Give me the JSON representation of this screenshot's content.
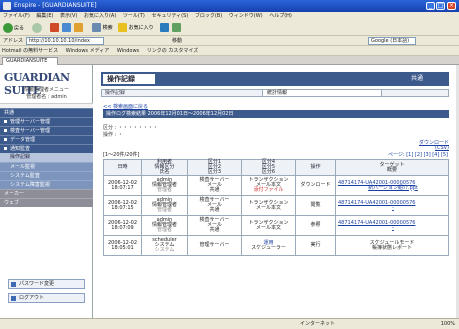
{
  "window": {
    "title": "Enspire - [GUARDIANSUITE]"
  },
  "menu": [
    "ファイル(F)",
    "編集(E)",
    "表示(V)",
    "お気に入り(A)",
    "ツール(T)",
    "セキュリティ(S)",
    "ブロック(B)",
    "ウィンドウ(W)",
    "ヘルプ(H)"
  ],
  "toolbar": {
    "back": "戻る",
    "search_label": "検索",
    "favorites_label": "お気に入り"
  },
  "address": {
    "label": "アドレス",
    "value": "http://10.10.10.10/index",
    "go": "移動",
    "search_field": "Google (日本語)"
  },
  "links": [
    "Hotmail の無料サービス",
    "Windows メディア",
    "Windows",
    "リンクの カスタマイズ"
  ],
  "tab": {
    "label": "GUARDIANSUITE"
  },
  "sidebar": {
    "logo": "GUARDIAN SUITE",
    "user_line1": "情報管理者メニュー",
    "user_line2": "管理者名 : admin",
    "items": [
      {
        "label": "共通",
        "style": "dark"
      },
      {
        "label": "管理サーバー管理",
        "style": "dark"
      },
      {
        "label": "検査サーバー管理",
        "style": "dark"
      },
      {
        "label": "データ管理",
        "style": "dark"
      },
      {
        "label": "通知監査",
        "style": "dark"
      },
      {
        "label": "操作記録",
        "style": "sel"
      },
      {
        "label": "メール監視",
        "style": "light"
      },
      {
        "label": "システム監査",
        "style": "light"
      },
      {
        "label": "システム障害監視",
        "style": "light"
      },
      {
        "label": "メーカー",
        "style": "gray"
      },
      {
        "label": "ウェブ",
        "style": "gray"
      }
    ],
    "password_button": "パスワード変更",
    "logout_button": "ログアウト"
  },
  "main": {
    "header_title": "操作記録",
    "header_right": "共通",
    "category_label": "操作記録",
    "category_value": "統計情報",
    "back_link": "<< 検索画面に戻る",
    "section_title": "操作ログ検索結果 2006年12月01日～2006年12月02日",
    "info_line1": "区分 : ・・・・・・・・",
    "info_line2": "操作 : ・",
    "download": "ダウンロード",
    "download_sub": "(CSV)",
    "count": "[1～20件/20件]",
    "pager": "ページ: [1] [2] [3] [4] [5]",
    "columns": [
      "日時",
      "利用者\n情報区分\n氏名",
      "区分1\n区分2\n区分3",
      "区分4\n区分5\n区分6",
      "操作",
      "ターゲット\n概要"
    ],
    "rows": [
      {
        "date": "2006-12-02",
        "time": "18:07:17",
        "u1": "admin",
        "u2": "情報管理者",
        "u3": "管理者",
        "c1": "検査サーバー",
        "c2": "メール",
        "c3": "共通",
        "d1": "トランザクション",
        "d2": "メール本文",
        "d3": "添付ファイル",
        "op": "ダウンロード",
        "t1": "48714174-UA42001-00000576",
        "t2": "新バージョン紹介.ppt"
      },
      {
        "date": "2006-12-02",
        "time": "18:07:15",
        "u1": "admin",
        "u2": "情報管理者",
        "u3": "管理者",
        "c1": "検査サーバー",
        "c2": "メール",
        "c3": "共通",
        "d1": "トランザクション",
        "d2": "メール本文",
        "d3": "",
        "op": "閲覧",
        "t1": "48714174-UA42001-00000576",
        "t2": "-"
      },
      {
        "date": "2006-12-02",
        "time": "18:07:09",
        "u1": "admin",
        "u2": "情報管理者",
        "u3": "管理者",
        "c1": "検査サーバー",
        "c2": "メール",
        "c3": "共通",
        "d1": "トランザクション",
        "d2": "メール本文",
        "d3": "",
        "op": "参照",
        "t1": "48714174-UA42001-00000576",
        "t2": "-"
      },
      {
        "date": "2006-12-02",
        "time": "18:05:01",
        "u1": "scheduler",
        "u2": "システム",
        "u3": "システム",
        "c1": "管理サーバー",
        "c2": "",
        "c3": "",
        "d1": "運用",
        "d2": "スケジューラー",
        "d3": "",
        "op": "実行",
        "t1": "スケジュールモード",
        "t2": "帳簿状態レポート"
      }
    ]
  },
  "status": {
    "left": "",
    "zone": "インターネット",
    "zoom": "100%"
  }
}
